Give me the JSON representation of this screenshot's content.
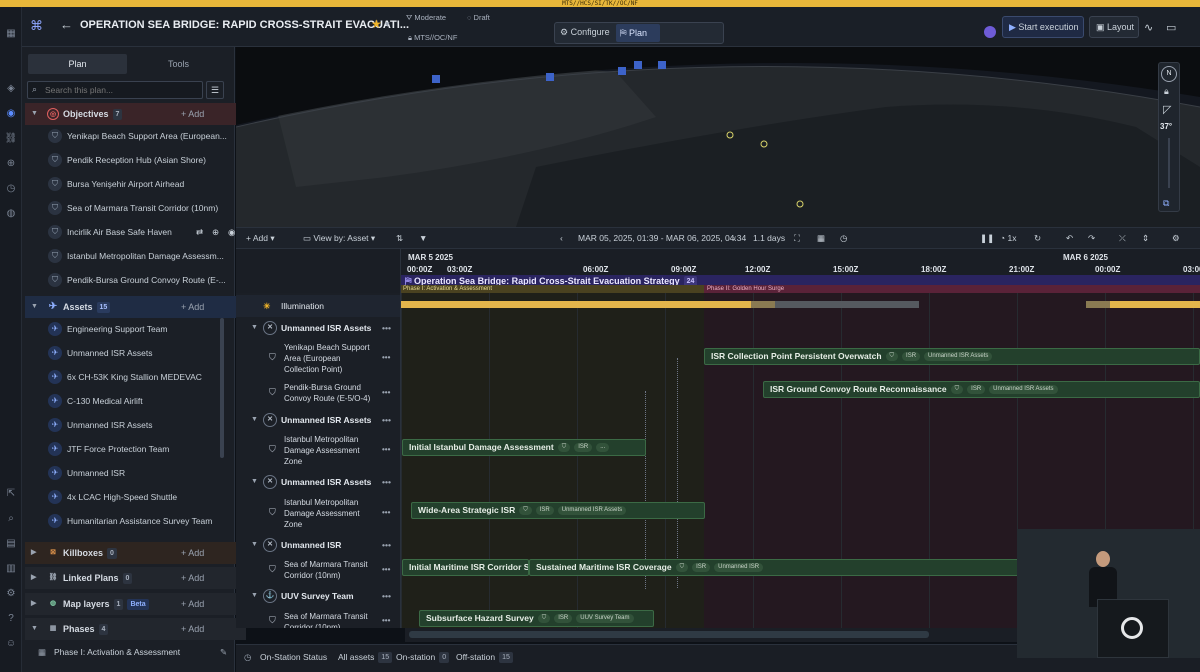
{
  "topstrip": "MTS//HCS/SI/TK//OC/NF",
  "header": {
    "title": "OPERATION SEA BRIDGE: RAPID CROSS-STRAIT EVACUATI...",
    "classification": "Moderate",
    "draft": "Draft",
    "sub": "MTS//OC/NF",
    "configure": "Configure",
    "plan": "Plan",
    "start": "Start execution",
    "layout": "Layout"
  },
  "sidebar": {
    "tabs": [
      "Plan",
      "Tools"
    ],
    "search_placeholder": "Search this plan...",
    "objectives": {
      "label": "Objectives",
      "count": "7",
      "add": "Add",
      "items": [
        "Yenikapı Beach Support Area (European...",
        "Pendik Reception Hub (Asian Shore)",
        "Bursa Yenişehir Airport Airhead",
        "Sea of Marmara Transit Corridor (10nm)",
        "Incirlik Air Base Safe Haven",
        "Istanbul Metropolitan Damage Assessm...",
        "Pendik-Bursa Ground Convoy Route (E-..."
      ]
    },
    "assets": {
      "label": "Assets",
      "count": "15",
      "add": "Add",
      "items": [
        "Engineering Support Team",
        "Unmanned ISR Assets",
        "6x CH-53K King Stallion MEDEVAC",
        "C-130 Medical Airlift",
        "Unmanned ISR Assets",
        "JTF Force Protection Team",
        "Unmanned ISR",
        "4x LCAC High-Speed Shuttle",
        "Humanitarian Assistance Survey Team"
      ]
    },
    "killboxes": {
      "label": "Killboxes",
      "count": "0",
      "add": "Add"
    },
    "linked": {
      "label": "Linked Plans",
      "count": "0",
      "add": "Add"
    },
    "maplayers": {
      "label": "Map layers",
      "count": "1",
      "beta": "Beta",
      "add": "Add"
    },
    "phases": {
      "label": "Phases",
      "count": "4",
      "add": "Add",
      "item": "Phase I: Activation & Assessment"
    }
  },
  "map": {
    "compass": "N",
    "angle": "37°"
  },
  "toolbar": {
    "add": "Add",
    "viewby": "View by: Asset",
    "range": "MAR 05, 2025, 01:39 - MAR 06, 2025, 04:34",
    "days": "1.1 days",
    "speed": "1x"
  },
  "timeline": {
    "day1": "MAR 5 2025",
    "day2": "MAR 6 2025",
    "ticks": [
      "00:00Z",
      "03:00Z",
      "06:00Z",
      "09:00Z",
      "12:00Z",
      "15:00Z",
      "18:00Z",
      "21:00Z",
      "00:00Z",
      "03:00Z"
    ],
    "plan_title": "Operation Sea Bridge: Rapid Cross-Strait Evacuation Strategy",
    "plan_count": "24",
    "phase1": "Phase I: Activation & Assessment",
    "phase2": "Phase II: Golden Hour Surge",
    "illumination": "Illumination"
  },
  "rows": {
    "g1": "Unmanned ISR Assets",
    "r1a": "Yenikapı Beach Support Area (European Collection Point)",
    "r1b": "Pendik-Bursa Ground Convoy Route (E-5/O-4)",
    "g2": "Unmanned ISR Assets",
    "r2": "Istanbul Metropolitan Damage Assessment Zone",
    "g3": "Unmanned ISR Assets",
    "r3": "Istanbul Metropolitan Damage Assessment Zone",
    "g4": "Unmanned ISR",
    "r4": "Sea of Marmara Transit Corridor (10nm)",
    "g5": "UUV Survey Team",
    "r5": "Sea of Marmara Transit Corridor (10nm)"
  },
  "bars": {
    "b1": "ISR Collection Point Persistent Overwatch",
    "b2": "ISR Ground Convoy Route Reconnaissance",
    "b3": "Initial Istanbul Damage Assessment",
    "b4": "Wide-Area Strategic ISR",
    "b5": "Initial Maritime ISR Corridor Su",
    "b6": "Sustained Maritime ISR Coverage",
    "b7": "Subsurface Hazard Survey",
    "chip_isr": "ISR",
    "chip_uisr": "Unmanned ISR Assets",
    "chip_uisr2": "Unmanned ISR",
    "chip_uuv": "UUV Survey Team",
    "chip_x": "..."
  },
  "bottom": {
    "status": "On-Station Status",
    "all": "All assets",
    "all_n": "15",
    "on": "On-station",
    "on_n": "0",
    "off": "Off-station",
    "off_n": "15"
  }
}
